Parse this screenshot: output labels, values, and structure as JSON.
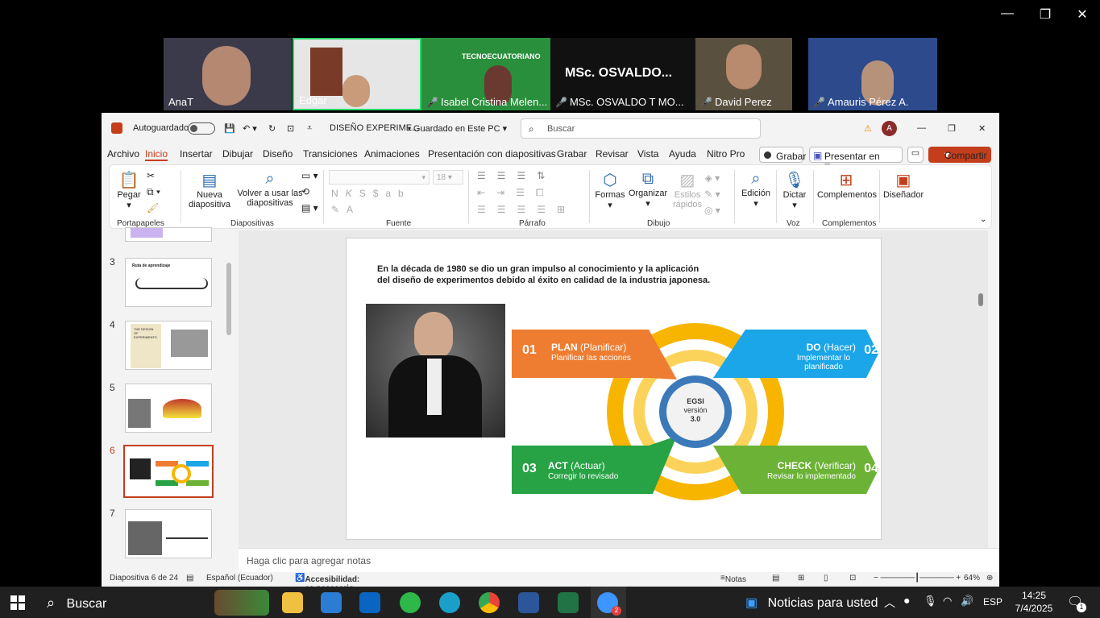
{
  "window": {
    "minimize": "—",
    "restore": "❐",
    "close": "✕"
  },
  "participants": [
    {
      "name": "AnaT",
      "bg": "#3a3a4a",
      "muted": false
    },
    {
      "name": "Edgar",
      "bg": "#e6e6e6",
      "muted": false,
      "active": true
    },
    {
      "name": "Isabel Cristina Melen...",
      "bg": "#2a8f3c",
      "muted": true,
      "banner": "TECNOECUATORIANO"
    },
    {
      "name": "MSc. OSVALDO T MO...",
      "bg": "#111111",
      "muted": true,
      "display": "MSc.  OSVALDO..."
    },
    {
      "name": "David Perez",
      "bg": "#5a5040",
      "muted": true
    },
    {
      "name": "Amauris Pérez A.",
      "bg": "#2c4a8c",
      "muted": true
    }
  ],
  "titlebar": {
    "autosave": "Autoguardado",
    "filename": "DISEÑO EXPERIME...",
    "saved": "• Guardado en Este PC",
    "search_placeholder": "Buscar",
    "avatar": "A"
  },
  "menu": [
    "Archivo",
    "Inicio",
    "Insertar",
    "Dibujar",
    "Diseño",
    "Transiciones",
    "Animaciones",
    "Presentación con diapositivas",
    "Grabar",
    "Revisar",
    "Vista",
    "Ayuda",
    "Nitro Pro"
  ],
  "menu_right": {
    "record": "Grabar",
    "teams": "Presentar en Teams",
    "share": "Compartir"
  },
  "ribbon": {
    "paste": "Pegar",
    "new_slide": "Nueva diapositiva",
    "reuse": "Volver a usar las diapositivas",
    "font_size": "18",
    "shapes": "Formas",
    "arrange": "Organizar",
    "quick_styles": "Estilos rápidos",
    "editing": "Edición",
    "dictate": "Dictar",
    "addins": "Complementos",
    "designer": "Diseñador",
    "groups": [
      "Portapapeles",
      "Diapositivas",
      "Fuente",
      "Párrafo",
      "Dibujo",
      "Voz",
      "Complementos"
    ]
  },
  "thumbnails": [
    {
      "num": "3",
      "title": "Ruta de aprendizaje"
    },
    {
      "num": "4",
      "title": "THE DESIGN OF EXPERIMENTS"
    },
    {
      "num": "5",
      "title": ""
    },
    {
      "num": "6",
      "title": "",
      "selected": true
    },
    {
      "num": "7",
      "title": ""
    }
  ],
  "slide": {
    "heading_line1": "En la década de 1980 se dio un gran impulso al conocimiento y la aplicación",
    "heading_line2": "del diseño de experimentos debido al éxito en calidad de la industria japonesa.",
    "cycle": {
      "center_line1": "EGSI",
      "center_line2": "versión",
      "center_line3": "3.0",
      "steps": [
        {
          "num": "01",
          "title": "PLAN",
          "sub": "(Planificar)",
          "desc": "Planificar las acciones",
          "color": "#ee7d31"
        },
        {
          "num": "02",
          "title": "DO",
          "sub": "(Hacer)",
          "desc": "Implementar lo planificado",
          "color": "#1aa6e8"
        },
        {
          "num": "03",
          "title": "ACT",
          "sub": "(Actuar)",
          "desc": "Corregir lo revisado",
          "color": "#27a244"
        },
        {
          "num": "04",
          "title": "CHECK",
          "sub": "(Verificar)",
          "desc": "Revisar lo implementado",
          "color": "#6bb236"
        }
      ]
    }
  },
  "notes": "Haga clic para agregar notas",
  "status": {
    "slide": "Diapositiva 6 de 24",
    "lang": "Español (Ecuador)",
    "access": "Accesibilidad: es necesario investigar",
    "notes": "Notas",
    "zoom": "64%"
  },
  "taskbar": {
    "search": "Buscar",
    "news": "Noticias para usted",
    "lang": "ESP",
    "time": "14:25",
    "date": "7/4/2025",
    "zoom_badge": "2",
    "notif": "1"
  }
}
